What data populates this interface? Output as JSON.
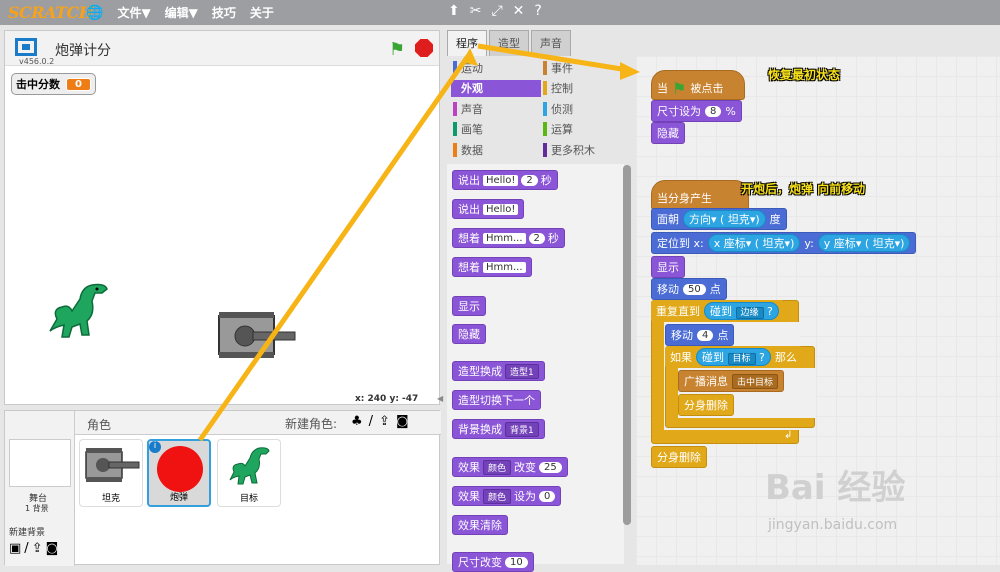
{
  "topbar": {
    "logo": "SCRATCH",
    "menus": [
      "文件▼",
      "编辑▼",
      "技巧",
      "关于"
    ]
  },
  "stage": {
    "title": "炮弹计分",
    "version": "v456.0.2",
    "monitor": {
      "label": "击中分数",
      "value": "0"
    },
    "coords": "x: 240  y: -47"
  },
  "sprites_panel": {
    "label": "角色",
    "new_sprite_label": "新建角色:",
    "stage_label": "舞台",
    "stage_sub": "1 背景",
    "new_backdrop": "新建背景",
    "sprites": [
      {
        "name": "坦克"
      },
      {
        "name": "炮弹"
      },
      {
        "name": "目标"
      }
    ]
  },
  "tabs": [
    "程序",
    "造型",
    "声音"
  ],
  "categories": [
    {
      "label": "运动",
      "color": "#4a6cd4"
    },
    {
      "label": "事件",
      "color": "#c88330"
    },
    {
      "label": "外观",
      "color": "#8a55d7"
    },
    {
      "label": "控制",
      "color": "#e1a91a"
    },
    {
      "label": "声音",
      "color": "#bb42c3"
    },
    {
      "label": "侦测",
      "color": "#2ca5e2"
    },
    {
      "label": "画笔",
      "color": "#0e9a6c"
    },
    {
      "label": "运算",
      "color": "#5cb712"
    },
    {
      "label": "数据",
      "color": "#ee7d16"
    },
    {
      "label": "更多积木",
      "color": "#632d99"
    }
  ],
  "palette_blocks": {
    "say_secs": {
      "label": "说出",
      "text": "Hello!",
      "num": "2",
      "unit": "秒"
    },
    "say": {
      "label": "说出",
      "text": "Hello!"
    },
    "think_secs": {
      "label": "想着",
      "text": "Hmm...",
      "num": "2",
      "unit": "秒"
    },
    "think": {
      "label": "想着",
      "text": "Hmm..."
    },
    "show": "显示",
    "hide": "隐藏",
    "switch_costume": {
      "label": "造型换成",
      "dd": "造型1"
    },
    "next_costume": "造型切换下一个",
    "switch_backdrop": {
      "label": "背景换成",
      "dd": "背景1"
    },
    "change_effect": {
      "label": "效果",
      "dd": "颜色",
      "mid": "改变",
      "num": "25"
    },
    "set_effect": {
      "label": "效果",
      "dd": "颜色",
      "mid": "设为",
      "num": "0"
    },
    "clear_effects": "效果清除",
    "change_size": {
      "label": "尺寸改变",
      "num": "10"
    }
  },
  "script1": {
    "annotation": "恢复最初状态",
    "hat_a": "当",
    "hat_b": "被点击",
    "set_size_a": "尺寸设为",
    "set_size_num": "8",
    "set_size_b": "%",
    "hide": "隐藏"
  },
  "script2": {
    "annotation": "开炮后，炮弹 向前移动",
    "hat": "当分身产生",
    "point_a": "面朝",
    "point_dd1": "方向",
    "point_dd2": "坦克",
    "point_b": "度",
    "goto_a": "定位到 x:",
    "goto_x1": "x 座标",
    "goto_x2": "坦克",
    "goto_b": "y:",
    "goto_y1": "y 座标",
    "goto_y2": "坦克",
    "show": "显示",
    "move_a": "移动",
    "move_num": "50",
    "move_b": "点",
    "repeat_until": "重复直到",
    "touching_a": "碰到",
    "touching_dd": "边缘",
    "touching_q": "?",
    "move2_num": "4",
    "if_a": "如果",
    "if_touch_dd": "目标",
    "if_b": "那么",
    "broadcast": "广播消息",
    "broadcast_dd": "击中目标",
    "delete_clone": "分身删除",
    "delete_clone2": "分身删除"
  },
  "watermark": {
    "main": "Bai 经验",
    "sub": "jingyan.baidu.com"
  }
}
